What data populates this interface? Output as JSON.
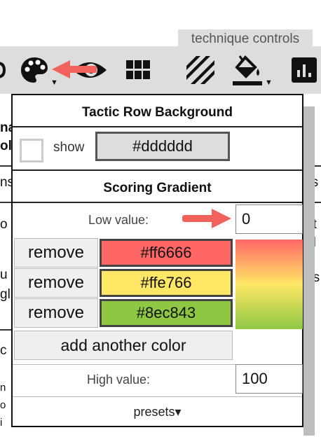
{
  "toolbar": {
    "technique_controls_label": "technique controls",
    "icons": [
      "palette-icon",
      "eye-icon",
      "grid-icon",
      "stripes-icon",
      "fill-bucket-icon",
      "bar-chart-icon"
    ]
  },
  "popup": {
    "tactic_row_title": "Tactic Row Background",
    "show_label": "show",
    "tactic_row_color": "#dddddd",
    "scoring_title": "Scoring Gradient",
    "low_label": "Low value:",
    "low_value": "0",
    "colors": [
      {
        "remove_label": "remove",
        "hex": "#ff6666"
      },
      {
        "remove_label": "remove",
        "hex": "#ffe766"
      },
      {
        "remove_label": "remove",
        "hex": "#8ec843"
      }
    ],
    "add_color_label": "add another color",
    "high_label": "High value:",
    "high_value": "100",
    "presets_label": "presets▾"
  },
  "colors": {
    "toolbar_bg": "#dddddd",
    "annotation_arrow": "#f0625b"
  }
}
